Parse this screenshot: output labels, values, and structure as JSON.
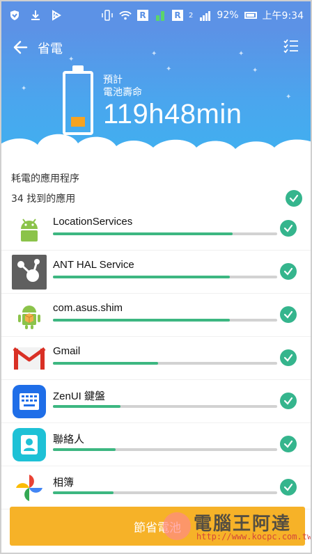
{
  "status_bar": {
    "r_icon_1": "R",
    "r_icon_2": "R",
    "signal_text": "2",
    "battery_percent": "92%",
    "time": "上午9:34",
    "icons_left": [
      "shield-icon",
      "download-icon",
      "flash-icon"
    ],
    "icons_right": [
      "vibrate-icon",
      "wifi-icon",
      "signal-icon",
      "battery-icon"
    ]
  },
  "header": {
    "title": "省電",
    "estimate_label_line1": "預計",
    "estimate_label_line2": "電池壽命",
    "estimate_value": "119h48min",
    "accent_color": "#5c92e6"
  },
  "list": {
    "section_title": "耗電的應用程序",
    "found_text": "34 找到的應用",
    "apps": [
      {
        "name": "LocationServices",
        "usage": 0.8,
        "icon": "android-icon"
      },
      {
        "name": "ANT HAL Service",
        "usage": 0.79,
        "icon": "ant-hal-icon"
      },
      {
        "name": "com.asus.shim",
        "usage": 0.79,
        "icon": "android-package-icon"
      },
      {
        "name": "Gmail",
        "usage": 0.47,
        "icon": "gmail-icon"
      },
      {
        "name": "ZenUI 鍵盤",
        "usage": 0.3,
        "icon": "keyboard-icon"
      },
      {
        "name": "聯絡人",
        "usage": 0.28,
        "icon": "contacts-icon"
      },
      {
        "name": "相簿",
        "usage": 0.27,
        "icon": "photos-icon"
      }
    ],
    "check_color": "#35b58d",
    "bar_color": "#3db781"
  },
  "save_button": {
    "label": "節省電池",
    "color": "#f6b228"
  },
  "watermark": {
    "title": "電腦王阿達",
    "url": "http://www.kocpc.com.tw"
  }
}
